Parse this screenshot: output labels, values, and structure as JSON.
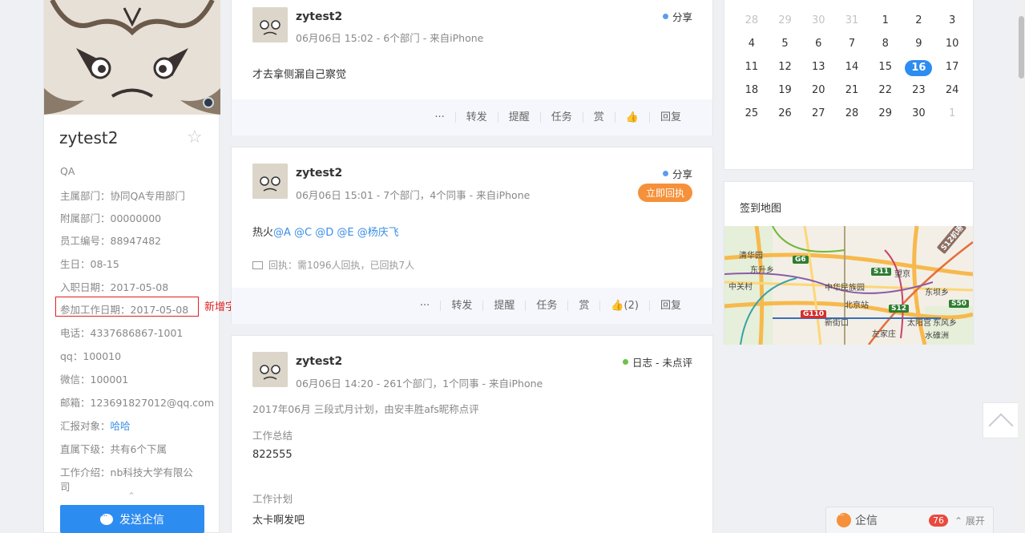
{
  "profile": {
    "name": "zytest2",
    "fields": [
      {
        "label": "QA",
        "value": ""
      },
      {
        "label": "主属部门：",
        "value": "协同QA专用部门"
      },
      {
        "label": "附属部门：",
        "value": "00000000"
      },
      {
        "label": "员工编号：",
        "value": "88947482"
      },
      {
        "label": "生日：",
        "value": "08-15"
      },
      {
        "label": "入职日期：",
        "value": "2017-05-08"
      },
      {
        "label": "参加工作日期：",
        "value": "2017-05-08"
      },
      {
        "label": "电话：",
        "value": "4337686867-1001"
      },
      {
        "label": "qq：",
        "value": "100010"
      },
      {
        "label": "微信：",
        "value": "100001"
      },
      {
        "label": "邮箱：",
        "value": "123691827012@qq.com"
      },
      {
        "label": "汇报对象：",
        "value": "哈哈"
      },
      {
        "label": "直属下级：",
        "value": "共有6个下属"
      },
      {
        "label": "工作介绍：",
        "value": "nb科技大学有限公"
      },
      {
        "label": "司",
        "value": ""
      }
    ],
    "new_field_note": "新增字段",
    "send_button": "发送企信"
  },
  "posts": [
    {
      "author": "zytest2",
      "meta": "06月06日 15:02 - 6个部门 - 来自iPhone",
      "tag": "分享",
      "tag_color": "#5b9cf0",
      "body": "才去拿侧漏自己察觉",
      "actions": [
        "···",
        "转发",
        "提醒",
        "任务",
        "赏",
        "👍",
        "回复"
      ]
    },
    {
      "author": "zytest2",
      "meta": "06月06日 15:01 - 7个部门，4个同事 - 来自iPhone",
      "tag": "分享",
      "tag_color": "#5b9cf0",
      "receipt_button": "立即回执",
      "body_prefix": "热火",
      "mentions": "@A @C @D @E @杨庆飞",
      "receipt_info": "回执：需1096人回执，已回执7人",
      "actions": [
        "···",
        "转发",
        "提醒",
        "任务",
        "赏",
        "👍(2)",
        "回复"
      ]
    },
    {
      "author": "zytest2",
      "meta": "06月06日 14:20 - 261个部门，1个同事 - 来自iPhone",
      "tag": "日志 - 未点评",
      "tag_color": "#6cc24a",
      "plan_line": "2017年06月 三段式月计划，由安丰胜afs昵称点评",
      "summary_label": "工作总结",
      "summary_value": "822555",
      "plan_label": "工作计划",
      "plan_value": "太卡啊发吧"
    }
  ],
  "calendar": {
    "rows": [
      [
        "28",
        "29",
        "30",
        "31",
        "1",
        "2",
        "3"
      ],
      [
        "4",
        "5",
        "6",
        "7",
        "8",
        "9",
        "10"
      ],
      [
        "11",
        "12",
        "13",
        "14",
        "15",
        "16",
        "17"
      ],
      [
        "18",
        "19",
        "20",
        "21",
        "22",
        "23",
        "24"
      ],
      [
        "25",
        "26",
        "27",
        "28",
        "29",
        "30",
        "1"
      ]
    ],
    "today": "16"
  },
  "map_card": {
    "title": "签到地图",
    "labels": [
      "清华园",
      "东升乡",
      "中关村",
      "中华民族园",
      "望京",
      "东坝乡",
      "北京站",
      "新街口",
      "左家庄",
      "太阳宫",
      "东风乡",
      "水碓洲"
    ],
    "badges": [
      "G6",
      "S11",
      "S12",
      "S50",
      "G110",
      "S12机场"
    ]
  },
  "im_bar": {
    "label": "企信",
    "count": "76",
    "expand": "展开"
  },
  "colors": {
    "accent": "#2d8cf0",
    "orange": "#f5913a",
    "red_note": "#e02020"
  }
}
